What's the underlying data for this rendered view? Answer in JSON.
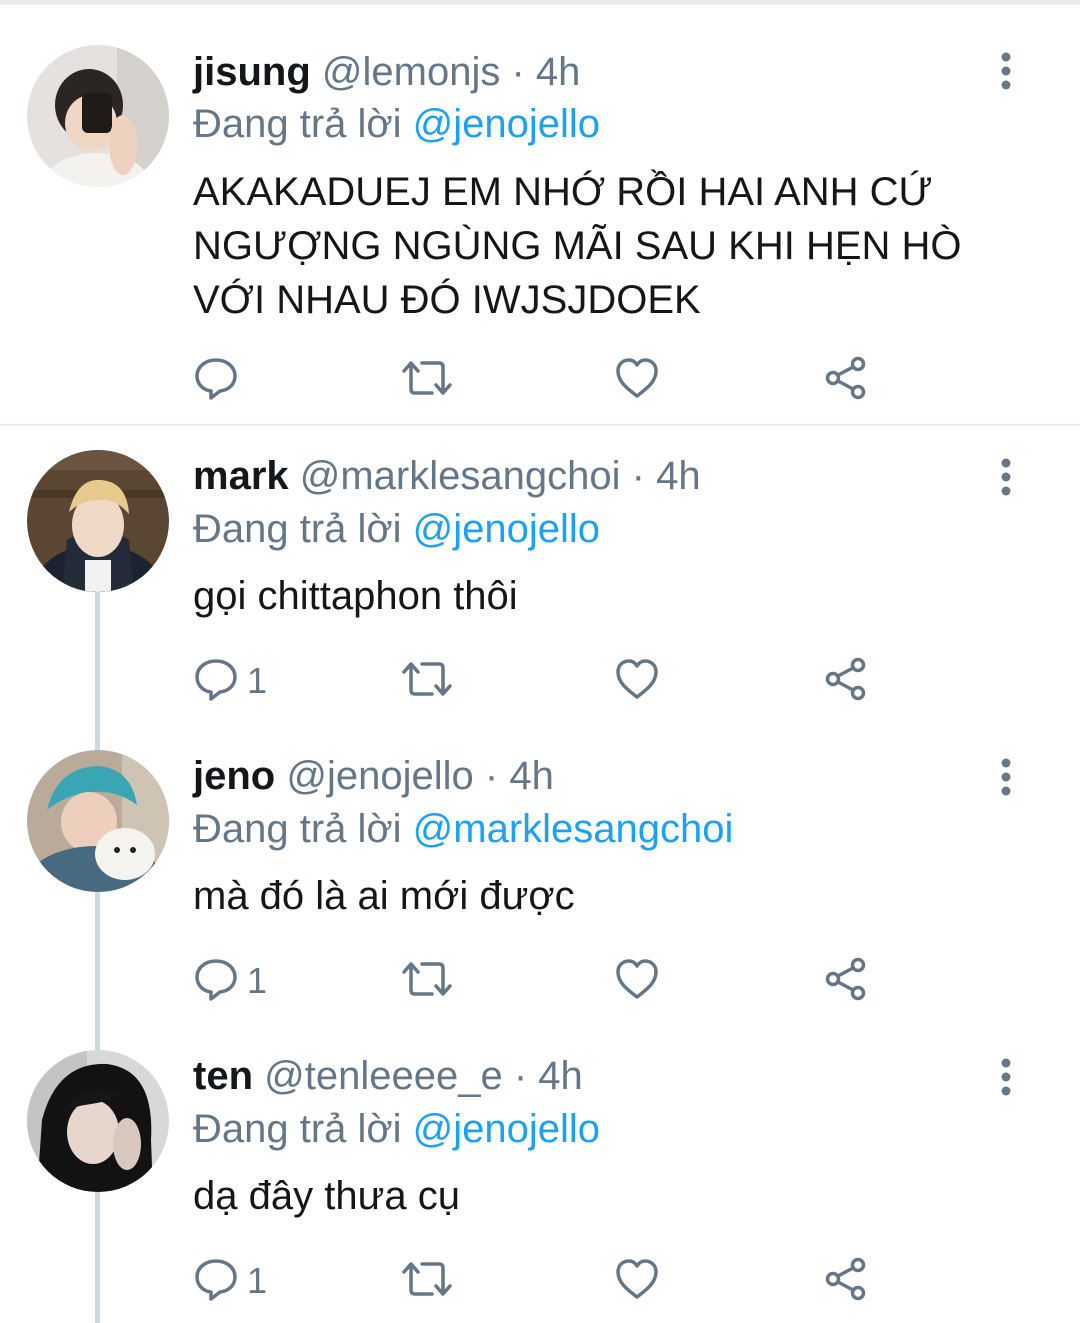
{
  "colors": {
    "text": "#14171a",
    "muted": "#657786",
    "link": "#1da1f2",
    "divider": "#e6ecf0",
    "thread_line": "#ccd6dd"
  },
  "icons": [
    "reply-icon",
    "retweet-icon",
    "like-icon",
    "share-icon",
    "more-options-icon"
  ],
  "tweets": [
    {
      "name": "jisung",
      "handle": "@lemonjs",
      "separator": "·",
      "time": "4h",
      "reply_prefix": "Đang trả lời",
      "reply_to": "@jenojello",
      "text": "AKAKADUEJ EM NHỚ RỒI HAI ANH CỨ NGƯỢNG NGÙNG MÃI SAU KHI HẸN HÒ VỚI NHAU ĐÓ IWJSJDOEK",
      "reply_count": ""
    },
    {
      "name": "mark",
      "handle": "@marklesangchoi",
      "separator": "·",
      "time": "4h",
      "reply_prefix": "Đang trả lời",
      "reply_to": "@jenojello",
      "text": "gọi chittaphon thôi",
      "reply_count": "1"
    },
    {
      "name": "jeno",
      "handle": "@jenojello",
      "separator": "·",
      "time": "4h",
      "reply_prefix": "Đang trả lời",
      "reply_to": "@marklesangchoi",
      "text": "mà đó là ai mới được",
      "reply_count": "1"
    },
    {
      "name": "ten",
      "handle": "@tenleeee_e",
      "separator": "·",
      "time": "4h",
      "reply_prefix": "Đang trả lời",
      "reply_to": "@jenojello",
      "text": "dạ đây thưa cụ",
      "reply_count": "1"
    }
  ]
}
